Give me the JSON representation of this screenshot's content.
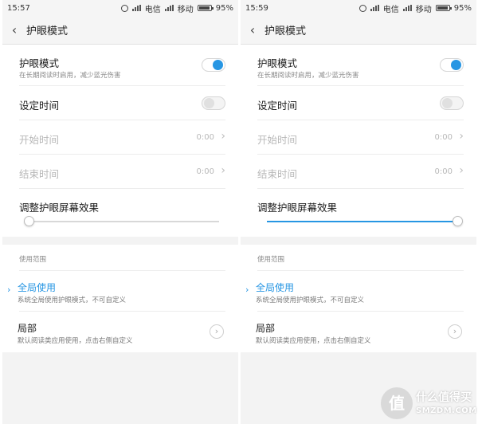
{
  "screens": [
    {
      "status": {
        "time": "15:57",
        "carrier1": "电信",
        "carrier2": "移动",
        "battery": "95%",
        "battery_level": 0.95
      },
      "header": {
        "back_icon": "chevron-left-icon",
        "title": "护眼模式"
      },
      "eye_mode": {
        "label": "护眼模式",
        "description": "在长期阅读时启用，减少蓝光伤害",
        "enabled": true
      },
      "schedule": {
        "label": "设定时间",
        "enabled": false
      },
      "start_time": {
        "label": "开始时间",
        "value": "0:00"
      },
      "end_time": {
        "label": "结束时间",
        "value": "0:00"
      },
      "effect": {
        "label": "调整护眼屏幕效果",
        "level": 0.0
      },
      "scope": {
        "section_label": "使用范围",
        "options": [
          {
            "label": "全局使用",
            "description": "系统全局使用护眼模式，不可自定义",
            "selected": true
          },
          {
            "label": "局部",
            "description": "默认阅读类应用使用，点击右侧自定义",
            "selected": false
          }
        ]
      }
    },
    {
      "status": {
        "time": "15:59",
        "carrier1": "电信",
        "carrier2": "移动",
        "battery": "95%",
        "battery_level": 0.95
      },
      "header": {
        "back_icon": "chevron-left-icon",
        "title": "护眼模式"
      },
      "eye_mode": {
        "label": "护眼模式",
        "description": "在长期阅读时启用，减少蓝光伤害",
        "enabled": true
      },
      "schedule": {
        "label": "设定时间",
        "enabled": false
      },
      "start_time": {
        "label": "开始时间",
        "value": "0:00"
      },
      "end_time": {
        "label": "结束时间",
        "value": "0:00"
      },
      "effect": {
        "label": "调整护眼屏幕效果",
        "level": 1.0
      },
      "scope": {
        "section_label": "使用范围",
        "options": [
          {
            "label": "全局使用",
            "description": "系统全局使用护眼模式，不可自定义",
            "selected": true
          },
          {
            "label": "局部",
            "description": "默认阅读类应用使用，点击右侧自定义",
            "selected": false
          }
        ]
      }
    }
  ],
  "watermark": {
    "badge": "值",
    "text_cn": "什么值得买",
    "text_en": "SMZDM.COM"
  },
  "colors": {
    "accent": "#2796e3",
    "background": "#f3f3f3",
    "card": "#ffffff"
  }
}
